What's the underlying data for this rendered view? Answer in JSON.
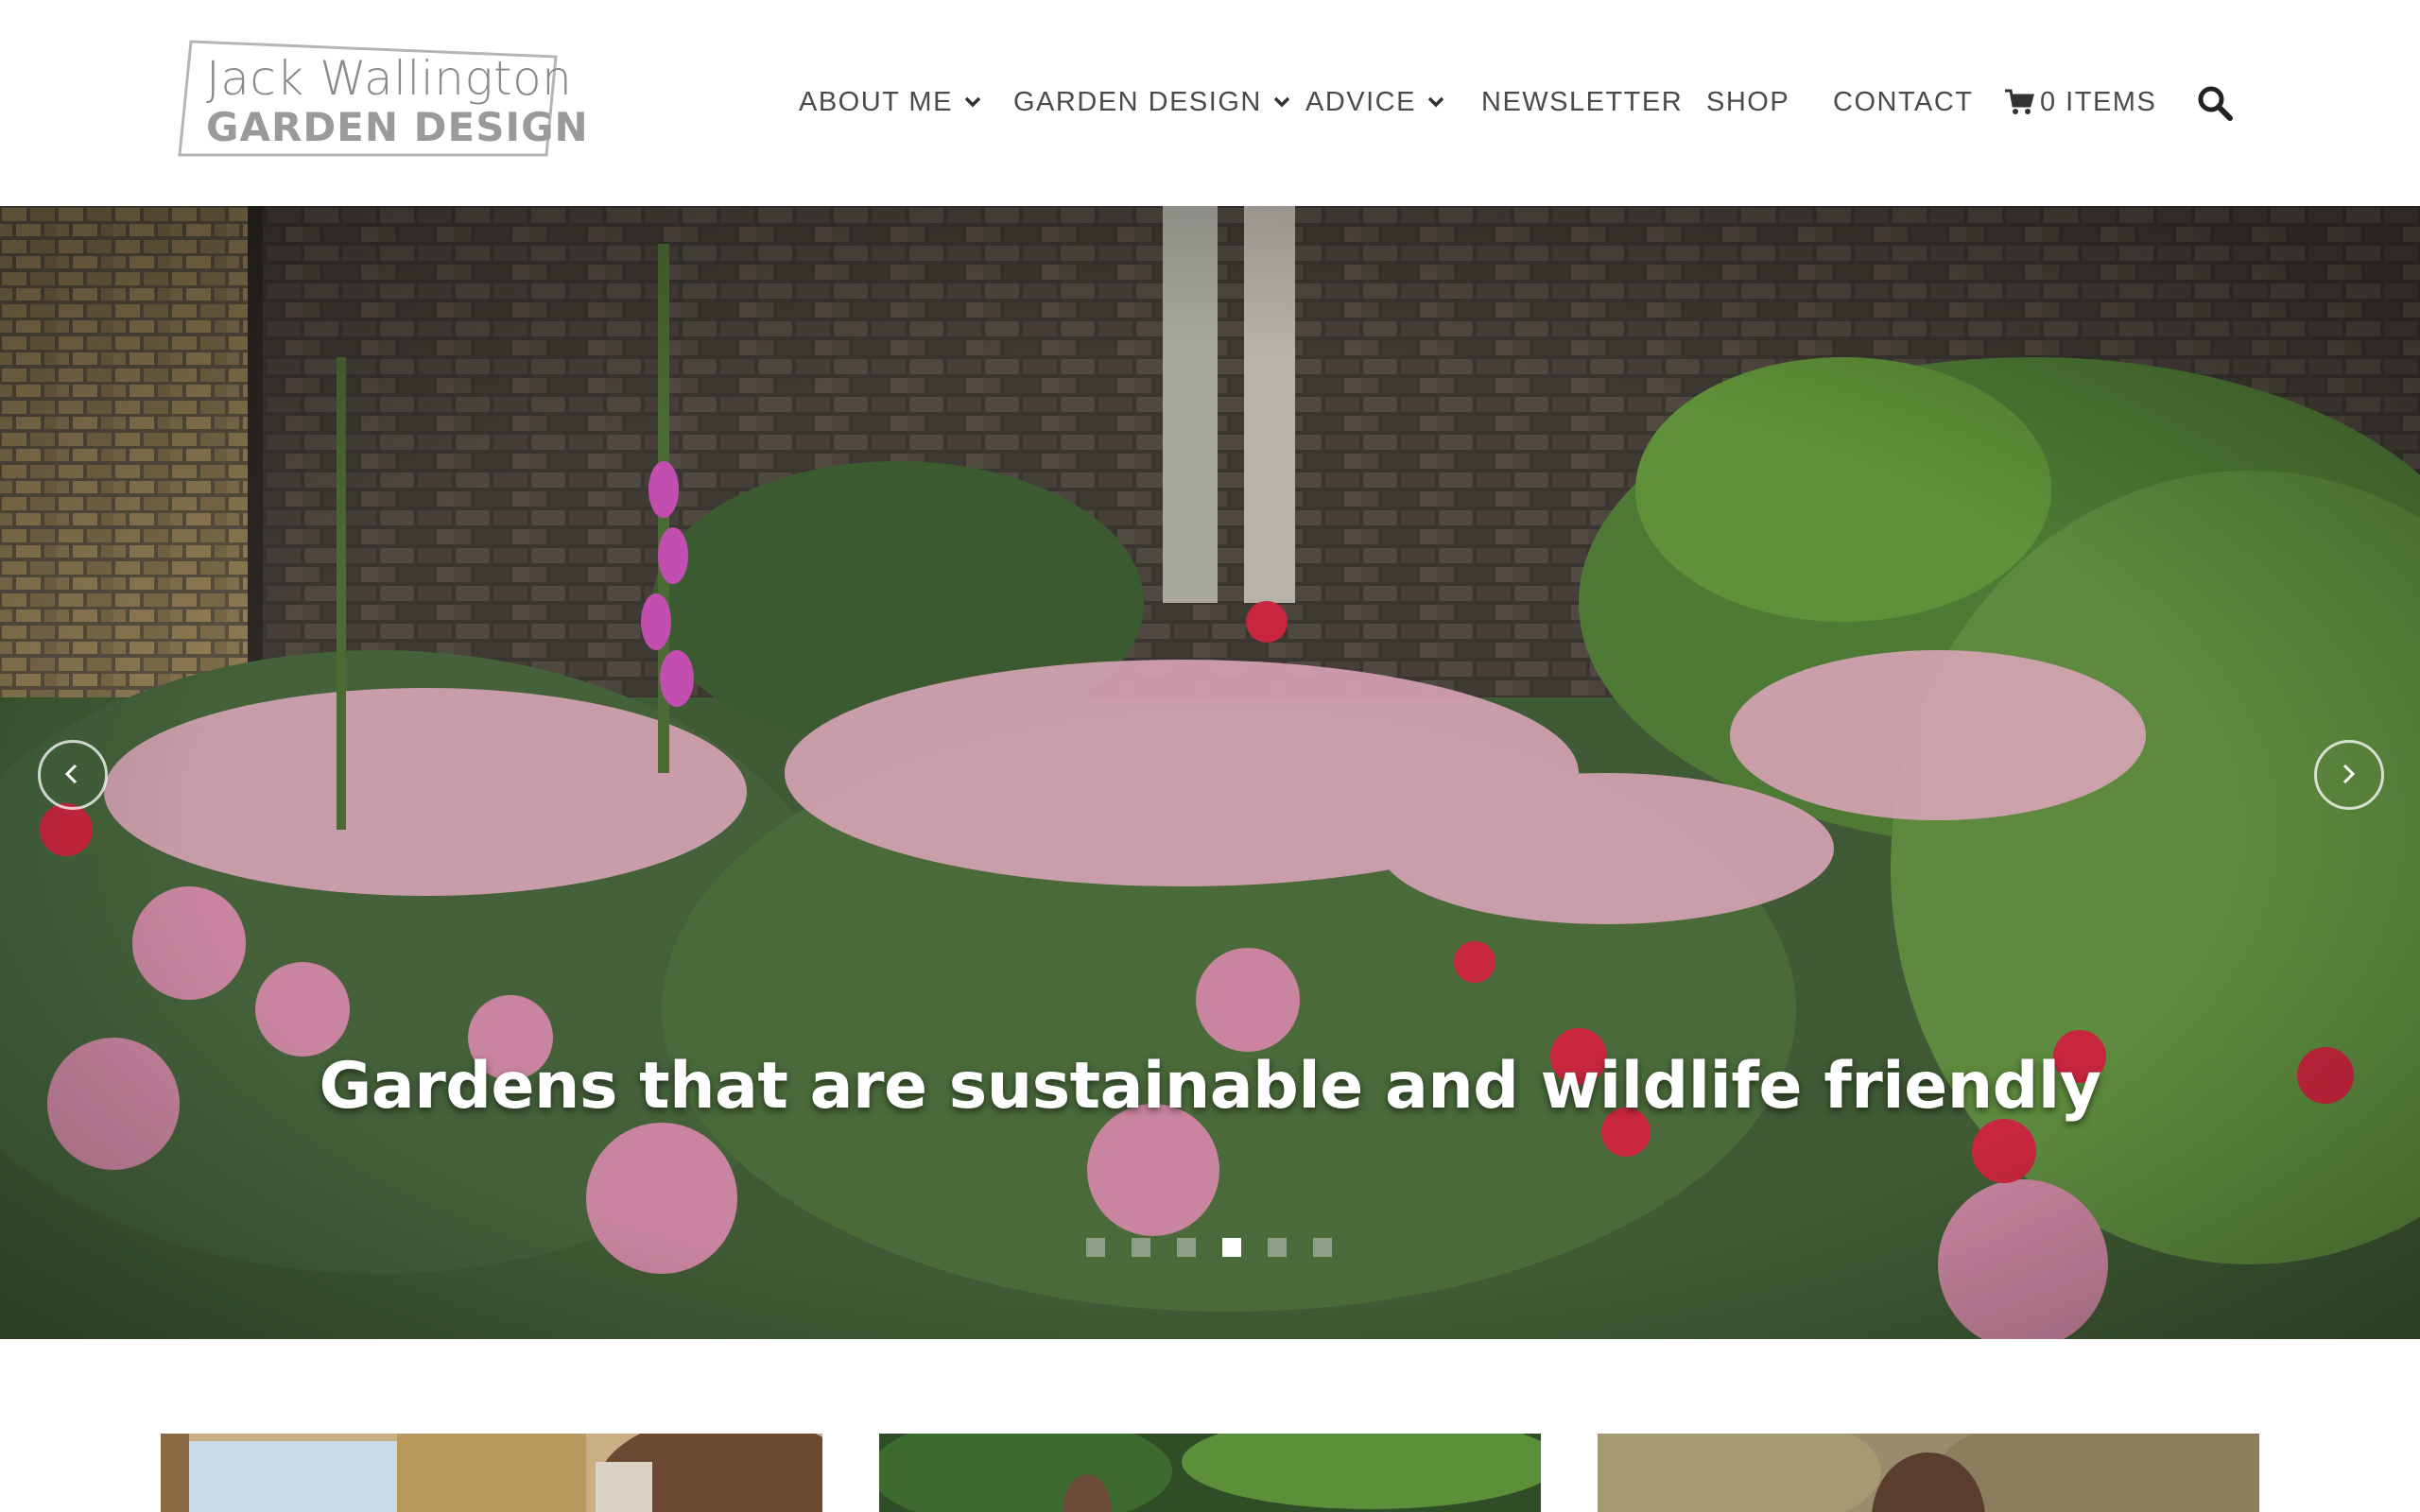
{
  "logo": {
    "line1": "Jack Wallington",
    "line2": "GARDEN DESIGN"
  },
  "nav": {
    "items": [
      {
        "label": "ABOUT ME",
        "has_dropdown": true
      },
      {
        "label": "GARDEN DESIGN",
        "has_dropdown": true
      },
      {
        "label": "ADVICE",
        "has_dropdown": true
      },
      {
        "label": "NEWSLETTER",
        "has_dropdown": false
      },
      {
        "label": "SHOP",
        "has_dropdown": false
      },
      {
        "label": "CONTACT",
        "has_dropdown": false
      }
    ],
    "cart_label": "0 ITEMS",
    "cart_icon": "cart-icon",
    "search_icon": "search-icon"
  },
  "hero": {
    "caption": "Gardens that are sustainable and wildlife friendly",
    "slide_count": 6,
    "active_slide": 4,
    "prev_icon": "chevron-left-icon",
    "next_icon": "chevron-right-icon"
  },
  "cards": [
    {
      "name": "card-image-1"
    },
    {
      "name": "card-image-2"
    },
    {
      "name": "card-image-3"
    }
  ],
  "colors": {
    "text": "#4a4a4a",
    "background": "#ffffff",
    "caption": "#ffffff"
  }
}
